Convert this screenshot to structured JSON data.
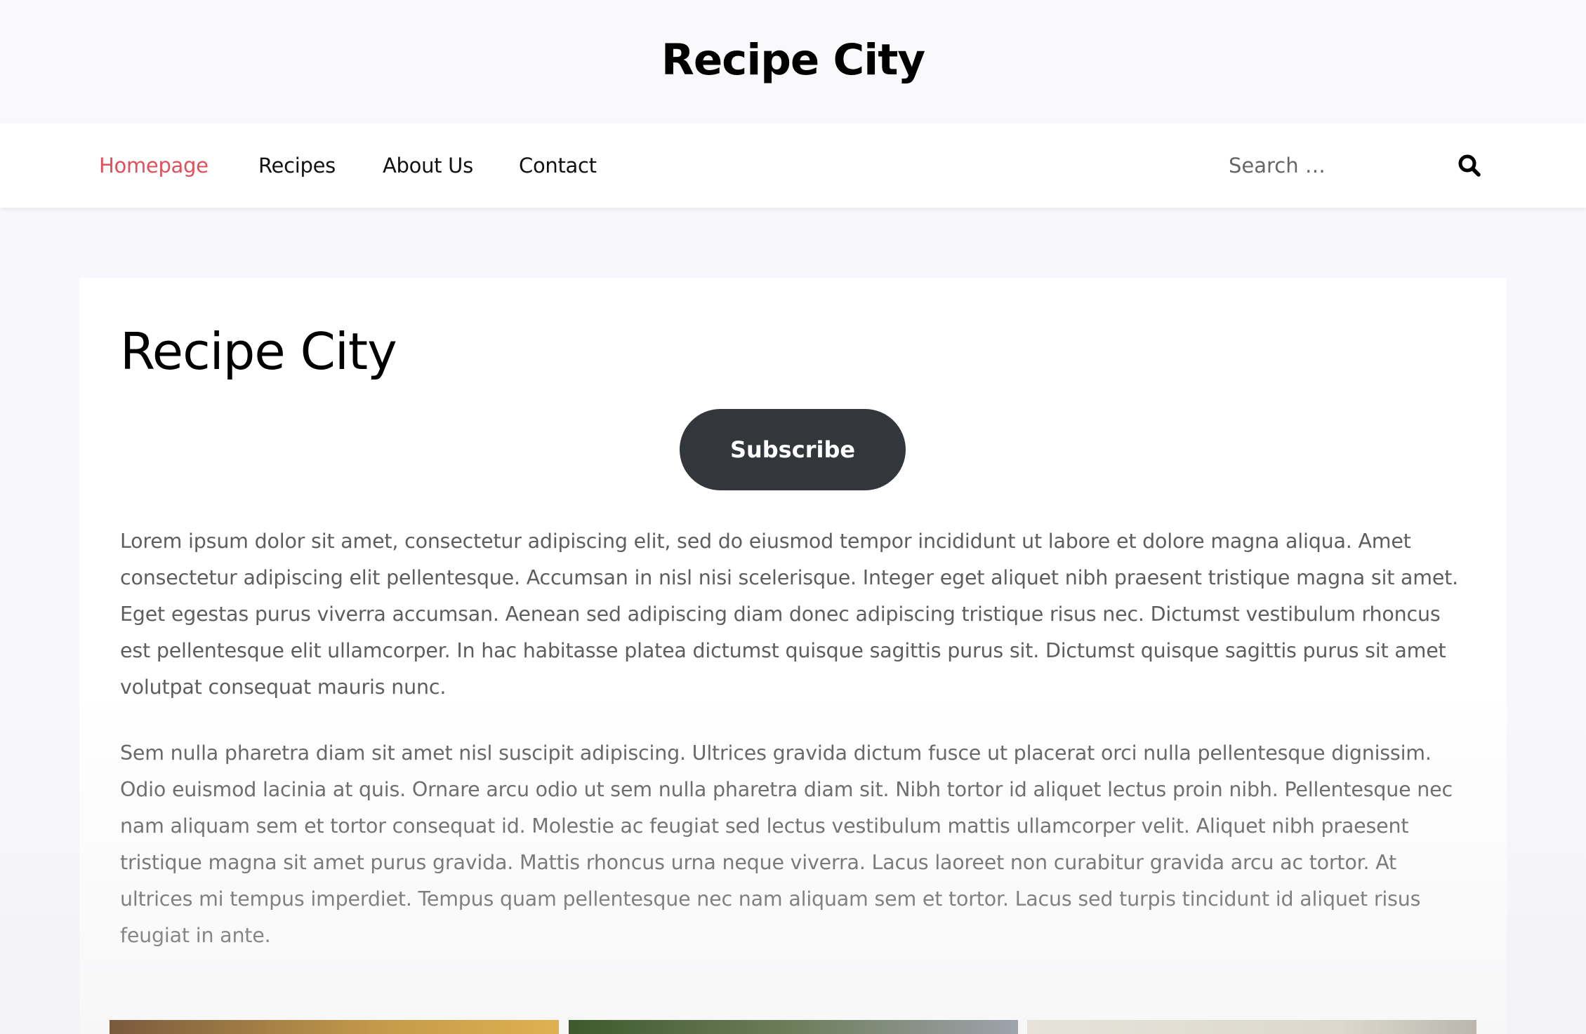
{
  "header": {
    "site_title": "Recipe City"
  },
  "nav": {
    "items": [
      {
        "label": "Homepage",
        "active": true
      },
      {
        "label": "Recipes",
        "active": false
      },
      {
        "label": "About Us",
        "active": false
      },
      {
        "label": "Contact",
        "active": false
      }
    ],
    "active_color": "#e0505a"
  },
  "search": {
    "placeholder": "Search …",
    "icon": "search-icon"
  },
  "main": {
    "heading": "Recipe City",
    "subscribe_label": "Subscribe",
    "paragraphs": [
      "Lorem ipsum dolor sit amet, consectetur adipiscing elit, sed do eiusmod tempor incididunt ut labore et dolore magna aliqua. Amet consectetur adipiscing elit pellentesque. Accumsan in nisl nisi scelerisque. Integer eget aliquet nibh praesent tristique magna sit amet. Eget egestas purus viverra accumsan. Aenean sed adipiscing diam donec adipiscing tristique risus nec. Dictumst vestibulum rhoncus est pellentesque elit ullamcorper. In hac habitasse platea dictumst quisque sagittis purus sit. Dictumst quisque sagittis purus sit amet volutpat consequat mauris nunc.",
      "Sem nulla pharetra diam sit amet nisl suscipit adipiscing. Ultrices gravida dictum fusce ut placerat orci nulla pellentesque dignissim. Odio euismod lacinia at quis. Ornare arcu odio ut sem nulla pharetra diam sit. Nibh tortor id aliquet lectus proin nibh. Pellentesque nec nam aliquam sem et tortor consequat id. Molestie ac feugiat sed lectus vestibulum mattis ullamcorper velit. Aliquet nibh praesent tristique magna sit amet purus gravida. Mattis rhoncus urna neque viverra. Lacus laoreet non curabitur gravida arcu ac tortor. At ultrices mi tempus imperdiet. Tempus quam pellentesque nec nam aliquam sem et tortor. Lacus sed turpis tincidunt id aliquet risus feugiat in ante."
    ]
  },
  "colors": {
    "header_bg": "#f9f9fc",
    "page_bg": "#f8f8fc",
    "button_bg": "#33373b",
    "body_text": "#5e5e5e"
  }
}
